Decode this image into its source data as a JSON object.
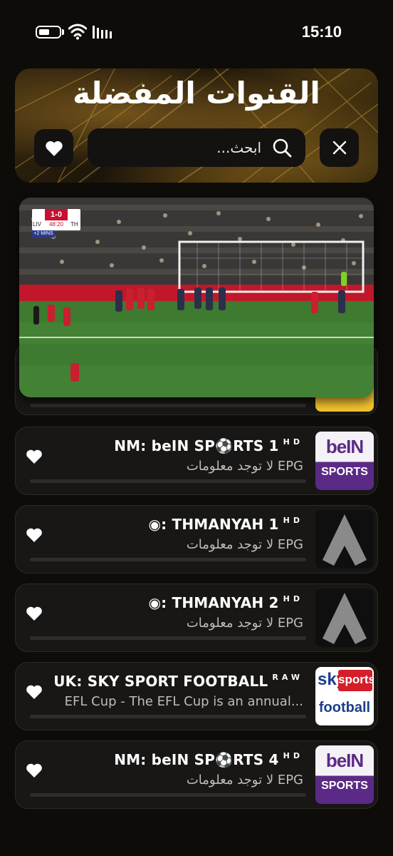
{
  "status_bar": {
    "time": "15:10"
  },
  "header": {
    "title": "القنوات المفضلة",
    "search_placeholder": "ابحث..."
  },
  "player": {
    "score": "1-0",
    "team_home": "LIV",
    "team_away": "TH",
    "match_time": "48:20",
    "added_time": "+2 MINS"
  },
  "channels": [
    {
      "name": "NM: beIN SP⚽RTS 1",
      "quality": "HD",
      "epg": "لا توجد معلومات EPG",
      "logo": "bein-sports-logo"
    },
    {
      "name": "◉: THMANYAH 1",
      "quality": "HD",
      "epg": "لا توجد معلومات EPG",
      "logo": "thmanyah-logo"
    },
    {
      "name": "◉: THMANYAH 2",
      "quality": "HD",
      "epg": "لا توجد معلومات EPG",
      "logo": "thmanyah-logo"
    },
    {
      "name": "UK: SKY SPORT FOOTBALL",
      "quality": "RAW",
      "epg": "EFL Cup - The EFL Cup is an annual...",
      "logo": "sky-sports-football-logo"
    },
    {
      "name": "NM: beIN SP⚽RTS 4",
      "quality": "HD",
      "epg": "لا توجد معلومات EPG",
      "logo": "bein-sports-logo"
    }
  ],
  "logos": {
    "bein_top": "beIN",
    "bein_bottom": "SPORTS",
    "sky_word": "sky",
    "sky_sports": "sports",
    "sky_football": "football"
  },
  "colors": {
    "background": "#0e0c09",
    "card": "#181715",
    "accent_gold": "#b08530",
    "bein_purple": "#5b2a86",
    "sky_red": "#d41f2a"
  }
}
